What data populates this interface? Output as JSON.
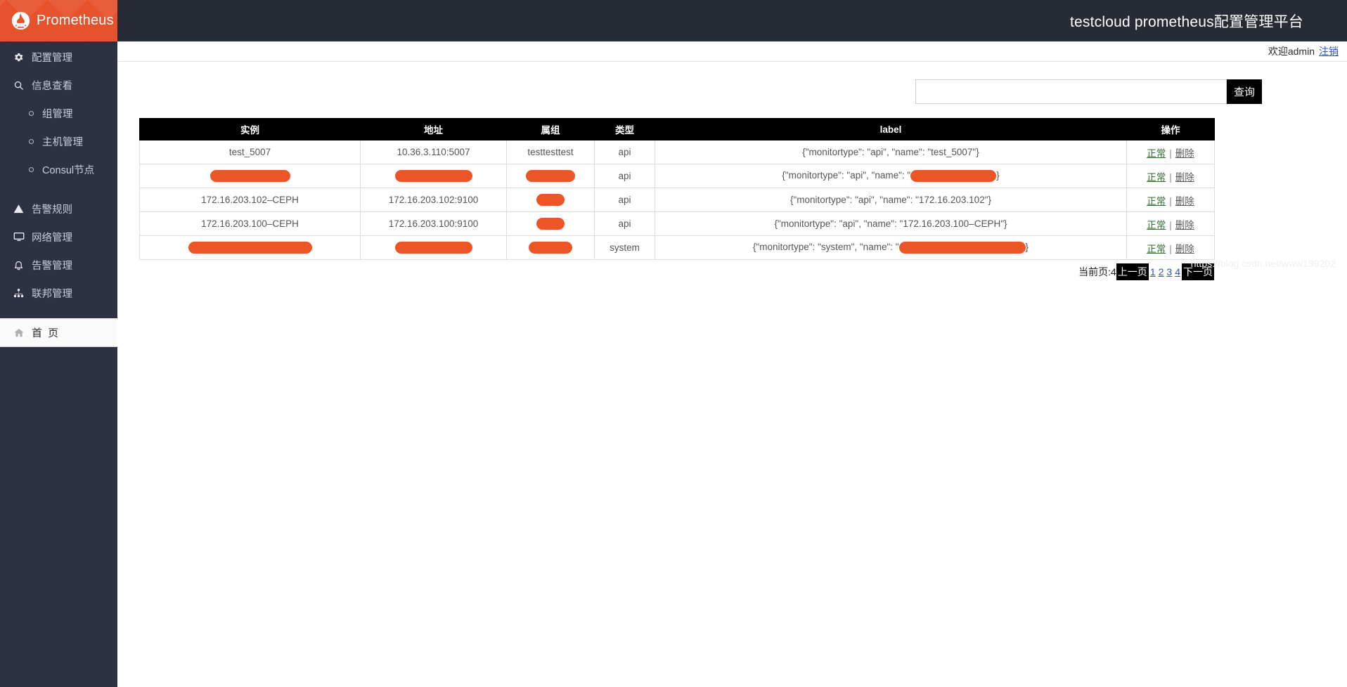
{
  "brand": {
    "name": "Prometheus",
    "logo_icon": "prometheus-torch-icon",
    "color": "#e6522c"
  },
  "sidebar": {
    "items": [
      {
        "label": "配置管理",
        "icon": "gear-icon",
        "level": "top"
      },
      {
        "label": "信息查看",
        "icon": "search-icon",
        "level": "top"
      },
      {
        "label": "组管理",
        "icon": "circle-bullet-icon",
        "level": "sub"
      },
      {
        "label": "主机管理",
        "icon": "circle-bullet-icon",
        "level": "sub"
      },
      {
        "label": "Consul节点",
        "icon": "circle-bullet-icon",
        "level": "sub"
      },
      {
        "label": "告警规则",
        "icon": "warning-triangle-icon",
        "level": "top"
      },
      {
        "label": "网络管理",
        "icon": "monitor-icon",
        "level": "top"
      },
      {
        "label": "告警管理",
        "icon": "bell-icon",
        "level": "top"
      },
      {
        "label": "联邦管理",
        "icon": "sitemap-icon",
        "level": "top"
      }
    ],
    "home": {
      "label": "首 页",
      "icon": "home-icon"
    }
  },
  "header": {
    "title": "testcloud prometheus配置管理平台",
    "welcome": "欢迎admin",
    "logout": "注销"
  },
  "search": {
    "value": "",
    "placeholder": "",
    "button_label": "查询"
  },
  "table": {
    "columns": [
      "实例",
      "地址",
      "属组",
      "类型",
      "label",
      "操作"
    ],
    "actions": {
      "ok": "正常",
      "separator": "|",
      "delete": "删除"
    },
    "rows": [
      {
        "instance": "test_5007",
        "instance_redacted": false,
        "address": "10.36.3.110:5007",
        "address_redacted": false,
        "group": "testtesttest",
        "group_redacted": false,
        "type": "api",
        "label": "{\"monitortype\": \"api\", \"name\": \"test_5007\"}",
        "label_redacted": false
      },
      {
        "instance": "",
        "instance_redacted": true,
        "instance_redact_width": 114,
        "address": "",
        "address_redacted": true,
        "address_redact_width": 110,
        "group": "",
        "group_redacted": true,
        "group_redact_width": 70,
        "type": "api",
        "label_prefix": "{\"monitortype\": \"api\", \"name\": \"",
        "label_suffix": "}",
        "label_redacted": true,
        "label_redact_width": 122
      },
      {
        "instance": "172.16.203.102–CEPH",
        "instance_redacted": false,
        "address": "172.16.203.102:9100",
        "address_redacted": false,
        "group": "",
        "group_redacted": true,
        "group_redact_width": 40,
        "type": "api",
        "label": "{\"monitortype\": \"api\", \"name\": \"172.16.203.102\"}",
        "label_redacted": false
      },
      {
        "instance": "172.16.203.100–CEPH",
        "instance_redacted": false,
        "address": "172.16.203.100:9100",
        "address_redacted": false,
        "group": "",
        "group_redacted": true,
        "group_redact_width": 40,
        "type": "api",
        "label": "{\"monitortype\": \"api\", \"name\": \"172.16.203.100–CEPH\"}",
        "label_redacted": false
      },
      {
        "instance": "",
        "instance_redacted": true,
        "instance_redact_width": 176,
        "address": "",
        "address_redacted": true,
        "address_redact_width": 110,
        "group": "",
        "group_redacted": true,
        "group_redact_width": 62,
        "type": "system",
        "label_prefix": "{\"monitortype\": \"system\", \"name\": \"",
        "label_suffix": "}",
        "label_redacted": true,
        "label_redact_width": 180
      }
    ]
  },
  "pagination": {
    "current_page_text": "当前页:4",
    "prev_label": "上一页",
    "next_label": "下一页",
    "pages": [
      "1",
      "2",
      "3",
      "4"
    ]
  },
  "watermark": {
    "text": "https://blog.csdn.net/www199202"
  }
}
